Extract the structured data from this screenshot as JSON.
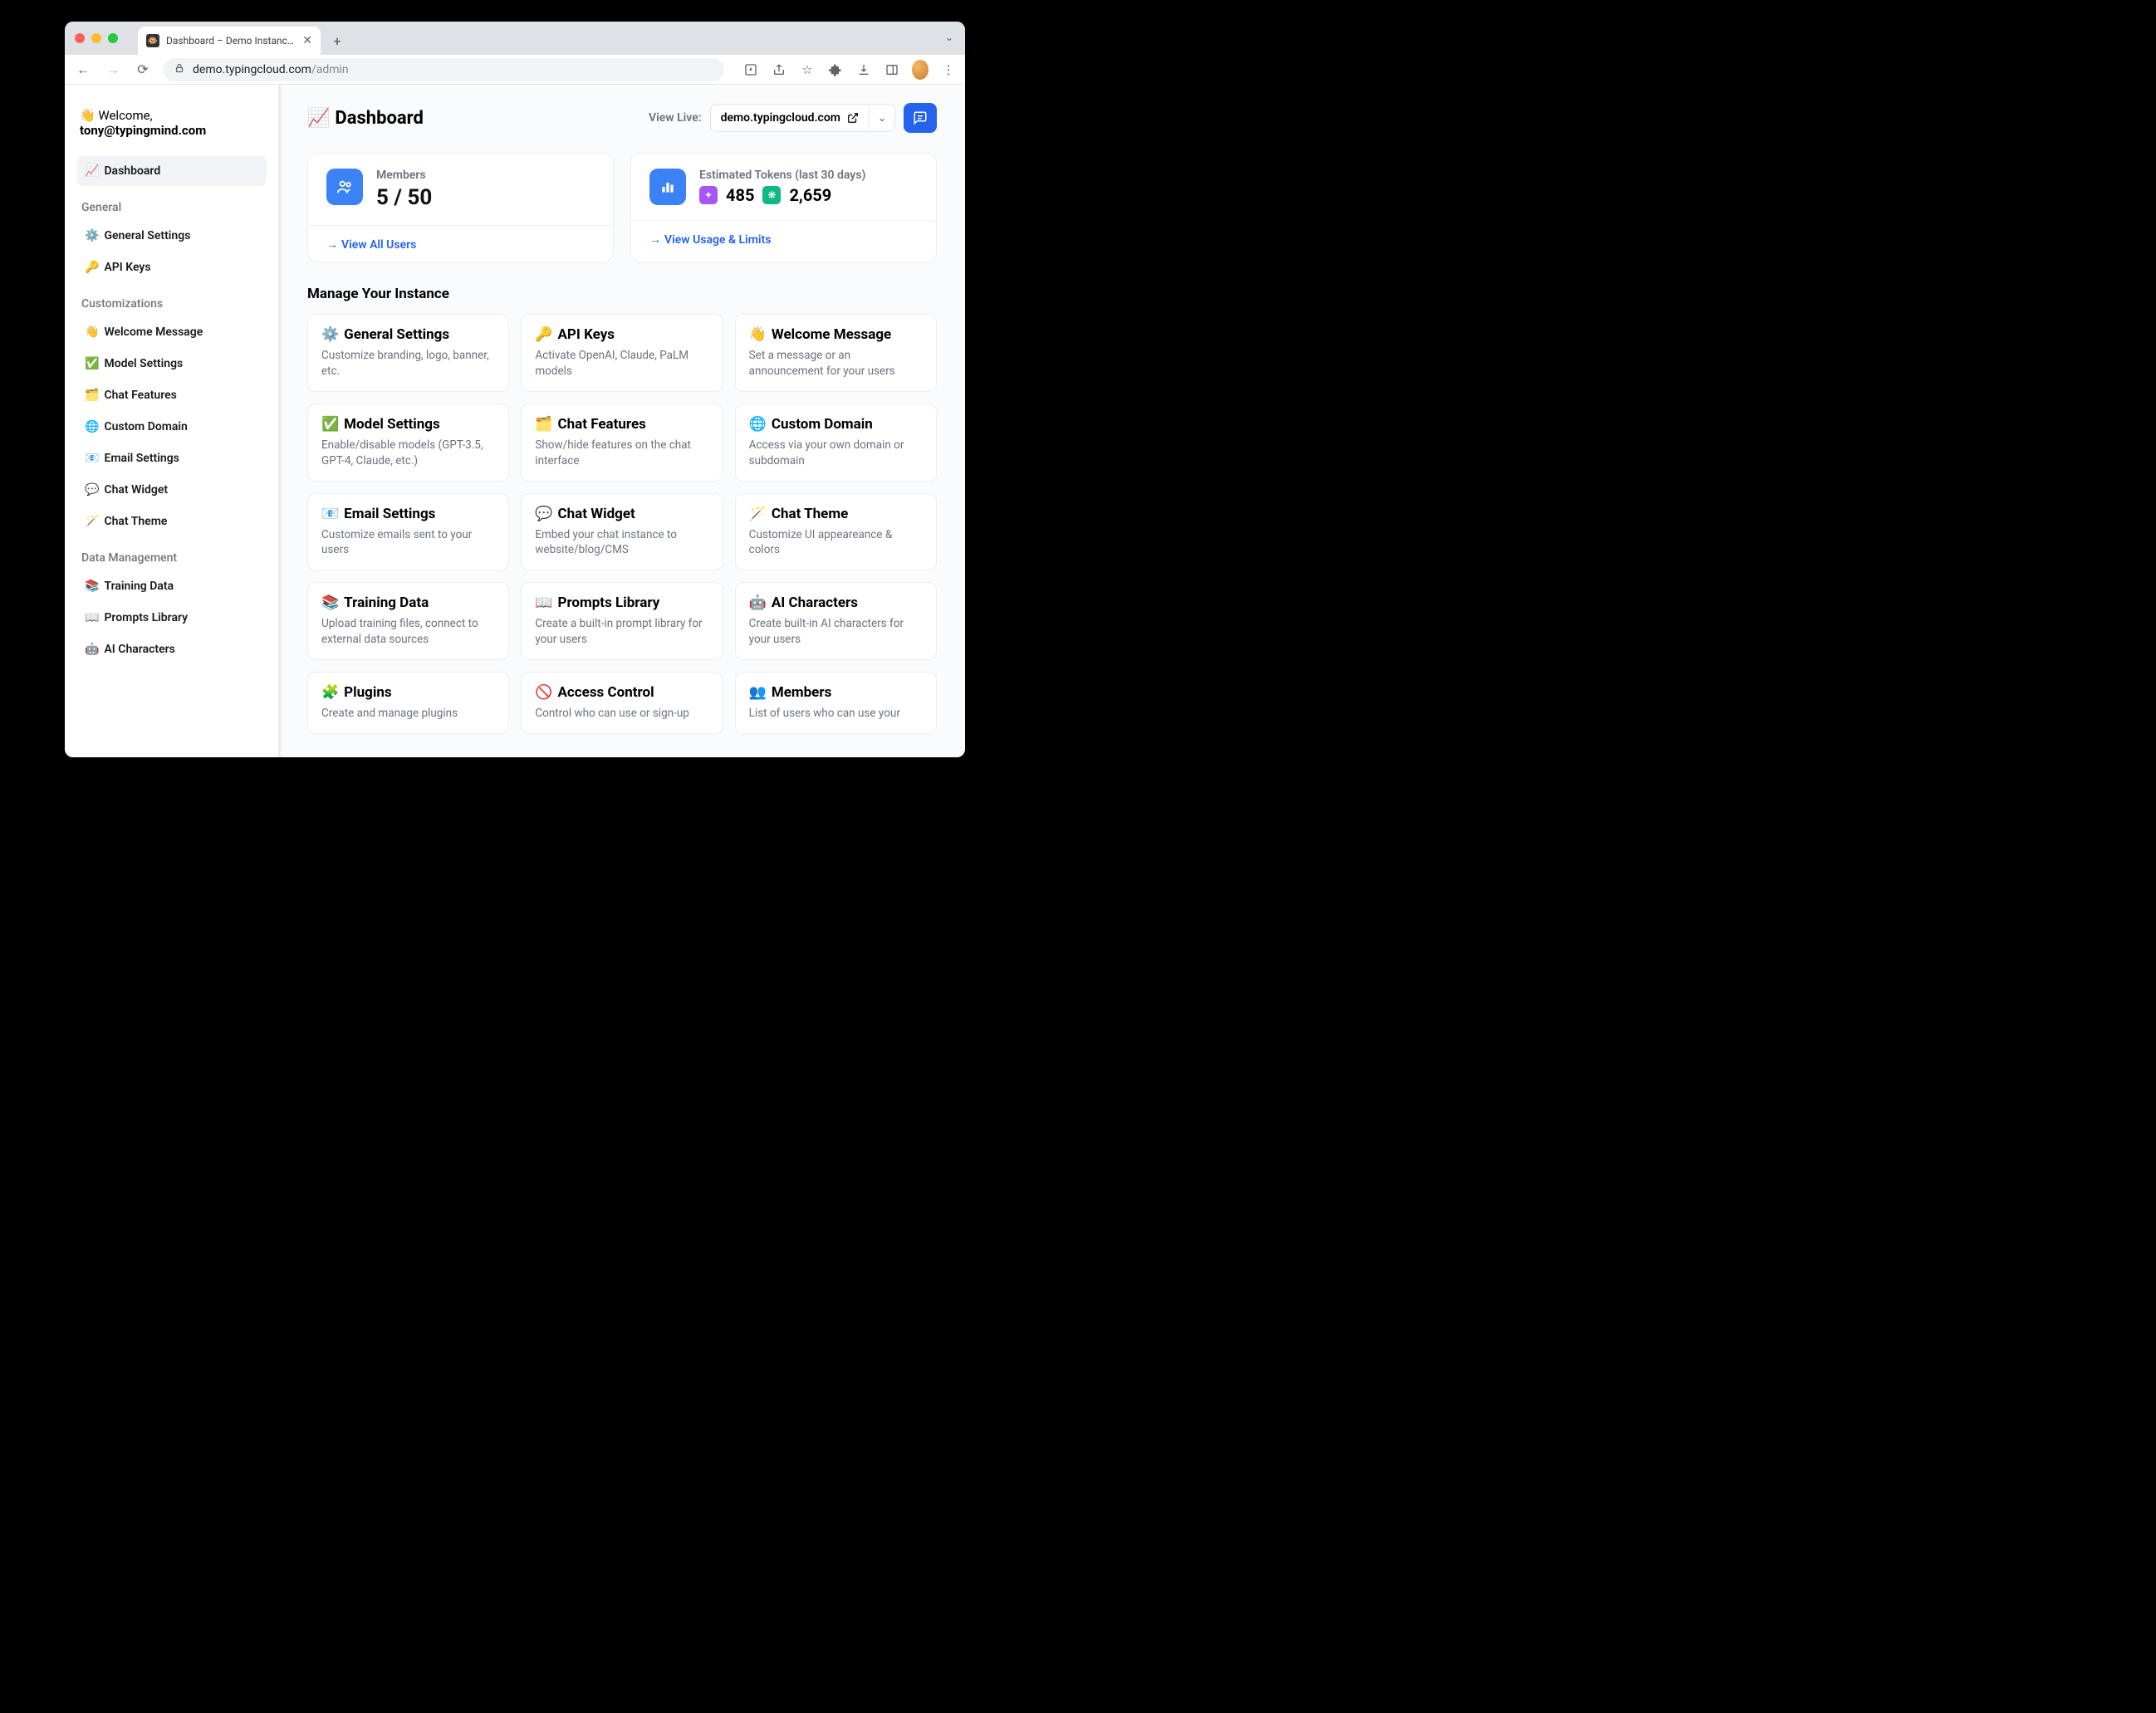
{
  "browser": {
    "tab_title": "Dashboard – Demo Instance – ",
    "url_host": "demo.typingcloud.com",
    "url_path": "/admin"
  },
  "sidebar": {
    "welcome_prefix": "👋 Welcome,",
    "welcome_email": "tony@typingmind.com",
    "items": [
      {
        "icon": "📈",
        "label": "Dashboard",
        "active": true
      }
    ],
    "sections": [
      {
        "title": "General",
        "items": [
          {
            "icon": "⚙️",
            "label": "General Settings"
          },
          {
            "icon": "🔑",
            "label": "API Keys"
          }
        ]
      },
      {
        "title": "Customizations",
        "items": [
          {
            "icon": "👋",
            "label": "Welcome Message"
          },
          {
            "icon": "✅",
            "label": "Model Settings"
          },
          {
            "icon": "🗂️",
            "label": "Chat Features"
          },
          {
            "icon": "🌐",
            "label": "Custom Domain"
          },
          {
            "icon": "📧",
            "label": "Email Settings"
          },
          {
            "icon": "💬",
            "label": "Chat Widget"
          },
          {
            "icon": "🪄",
            "label": "Chat Theme"
          }
        ]
      },
      {
        "title": "Data Management",
        "items": [
          {
            "icon": "📚",
            "label": "Training Data"
          },
          {
            "icon": "📖",
            "label": "Prompts Library"
          },
          {
            "icon": "🤖",
            "label": "AI Characters"
          }
        ]
      }
    ]
  },
  "header": {
    "title_icon": "📈",
    "title": "Dashboard",
    "view_live_label": "View Live:",
    "domain": "demo.typingcloud.com"
  },
  "stats": {
    "members": {
      "label": "Members",
      "value": "5 / 50",
      "link": "View All Users"
    },
    "tokens": {
      "label": "Estimated Tokens (last 30 days)",
      "provider1_count": "485",
      "provider2_count": "2,659",
      "link": "View Usage & Limits"
    }
  },
  "manage": {
    "section_title": "Manage Your Instance",
    "cards": [
      {
        "icon": "⚙️",
        "title": "General Settings",
        "desc": "Customize branding, logo, banner, etc."
      },
      {
        "icon": "🔑",
        "title": "API Keys",
        "desc": "Activate OpenAI, Claude, PaLM models"
      },
      {
        "icon": "👋",
        "title": "Welcome Message",
        "desc": "Set a message or an announcement for your users"
      },
      {
        "icon": "✅",
        "title": "Model Settings",
        "desc": "Enable/disable models (GPT-3.5, GPT-4, Claude, etc.)"
      },
      {
        "icon": "🗂️",
        "title": "Chat Features",
        "desc": "Show/hide features on the chat interface"
      },
      {
        "icon": "🌐",
        "title": "Custom Domain",
        "desc": "Access via your own domain or subdomain"
      },
      {
        "icon": "📧",
        "title": "Email Settings",
        "desc": "Customize emails sent to your users"
      },
      {
        "icon": "💬",
        "title": "Chat Widget",
        "desc": "Embed your chat instance to website/blog/CMS"
      },
      {
        "icon": "🪄",
        "title": "Chat Theme",
        "desc": "Customize UI appeareance & colors"
      },
      {
        "icon": "📚",
        "title": "Training Data",
        "desc": "Upload training files, connect to external data sources"
      },
      {
        "icon": "📖",
        "title": "Prompts Library",
        "desc": "Create a built-in prompt library for your users"
      },
      {
        "icon": "🤖",
        "title": "AI Characters",
        "desc": "Create built-in AI characters for your users"
      },
      {
        "icon": "🧩",
        "title": "Plugins",
        "desc": "Create and manage plugins"
      },
      {
        "icon": "🚫",
        "title": "Access Control",
        "desc": "Control who can use or sign-up"
      },
      {
        "icon": "👥",
        "title": "Members",
        "desc": "List of users who can use your"
      }
    ]
  }
}
